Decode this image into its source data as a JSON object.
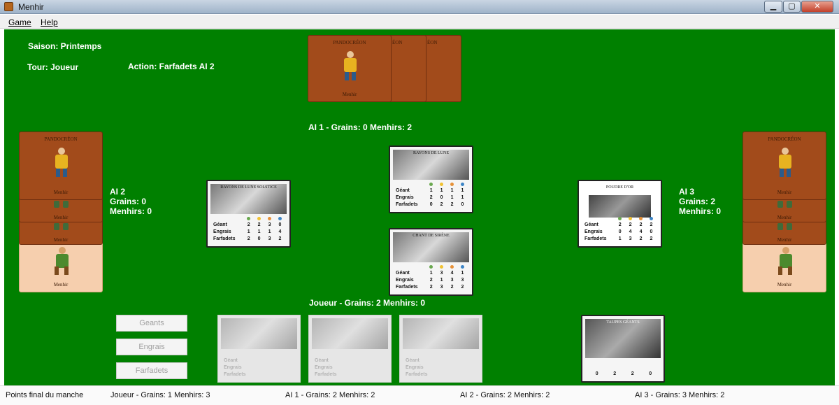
{
  "window": {
    "title": "Menhir",
    "min_label": "▁",
    "max_label": "▢",
    "close_label": "✕"
  },
  "menu": {
    "game": "Game",
    "help": "Help"
  },
  "game": {
    "season": "Saison: Printemps",
    "turn": "Tour: Joueur",
    "action": "Action: Farfadets AI 2",
    "ai1_info": "AI 1 - Grains: 0 Menhirs: 2",
    "ai2_info": "AI 2\nGrains: 0\nMenhirs: 0",
    "ai3_info": "AI 3\nGrains: 2\nMenhirs: 0",
    "player_info": "Joueur  - Grains: 2 Menhirs: 0"
  },
  "cards": {
    "back_top": "PANDOCRÉON",
    "back_top_short": "ÉON",
    "back_bottom": "Menhir",
    "play_area": [
      {
        "title": "RAYONS DE LUNE",
        "rows": [
          {
            "name": "Géant",
            "values": [
              "1",
              "1",
              "1",
              "1"
            ]
          },
          {
            "name": "Engrais",
            "values": [
              "2",
              "0",
              "1",
              "1"
            ]
          },
          {
            "name": "Farfadets",
            "values": [
              "0",
              "2",
              "2",
              "0"
            ]
          }
        ]
      },
      {
        "title": "CHANT DE SIRÈNE",
        "rows": [
          {
            "name": "Géant",
            "values": [
              "1",
              "3",
              "4",
              "1"
            ]
          },
          {
            "name": "Engrais",
            "values": [
              "2",
              "1",
              "3",
              "3"
            ]
          },
          {
            "name": "Farfadets",
            "values": [
              "2",
              "3",
              "2",
              "2"
            ]
          }
        ]
      }
    ],
    "ai2_played": {
      "title": "RAYONS DE LUNE SOLSTICE",
      "rows": [
        {
          "name": "Géant",
          "values": [
            "2",
            "2",
            "3",
            "0"
          ]
        },
        {
          "name": "Engrais",
          "values": [
            "1",
            "1",
            "1",
            "4"
          ]
        },
        {
          "name": "Farfadets",
          "values": [
            "2",
            "0",
            "3",
            "2"
          ]
        }
      ]
    },
    "ai3_played": {
      "title": "POUDRE D'OR",
      "rows": [
        {
          "name": "Géant",
          "values": [
            "2",
            "2",
            "2",
            "2"
          ]
        },
        {
          "name": "Engrais",
          "values": [
            "0",
            "4",
            "4",
            "0"
          ]
        },
        {
          "name": "Farfadets",
          "values": [
            "1",
            "3",
            "2",
            "2"
          ]
        }
      ]
    },
    "hand_faded": [
      {
        "rows": [
          {
            "name": "Géant"
          },
          {
            "name": "Engrais"
          },
          {
            "name": "Farfadets"
          }
        ]
      },
      {
        "rows": [
          {
            "name": "Géant"
          },
          {
            "name": "Engrais"
          },
          {
            "name": "Farfadets"
          }
        ]
      },
      {
        "rows": [
          {
            "name": "Géant"
          },
          {
            "name": "Engrais"
          },
          {
            "name": "Farfadets"
          }
        ]
      }
    ],
    "player_ally": {
      "title": "TAUPES GÉANTS",
      "values": [
        "0",
        "2",
        "2",
        "0"
      ]
    }
  },
  "buttons": {
    "geants": "Geants",
    "engrais": "Engrais",
    "farfadets": "Farfadets"
  },
  "status": {
    "label": "Points final du manche",
    "joueur": "Joueur  - Grains: 1 Menhirs: 3",
    "ai1": "AI 1 - Grains: 2 Menhirs: 2",
    "ai2": "AI 2 - Grains: 2 Menhirs: 2",
    "ai3": "AI 3 - Grains: 3 Menhirs: 2"
  },
  "colors": {
    "table": "#008000",
    "card_back": "#a24b1b",
    "ally_back": "#f6cfae"
  }
}
